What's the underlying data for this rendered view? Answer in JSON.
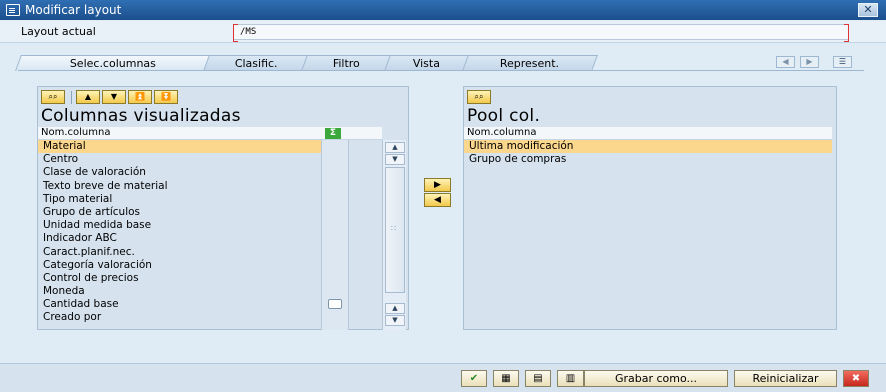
{
  "window": {
    "title": "Modificar layout",
    "close_label": "✕"
  },
  "layout": {
    "label": "Layout actual",
    "value": "/MS"
  },
  "tabs": [
    {
      "label": "Selec.columnas",
      "active": true
    },
    {
      "label": "Clasific.",
      "active": false
    },
    {
      "label": "Filtro",
      "active": false
    },
    {
      "label": "Vista",
      "active": false
    },
    {
      "label": "Represent.",
      "active": false
    }
  ],
  "left_panel": {
    "title": "Columnas visualizadas",
    "column_header": "Nom.columna",
    "sum_icon_label": "Σ",
    "items": [
      "Material",
      "Centro",
      "Clase de valoración",
      "Texto breve de material",
      "Tipo material",
      "Grupo de artículos",
      "Unidad medida base",
      "Indicador ABC",
      "Caract.planif.nec.",
      "Categoría valoración",
      "Control de precios",
      "Moneda",
      "Cantidad base",
      "Creado por"
    ],
    "selected_index": 0
  },
  "right_panel": {
    "title": "Pool col.",
    "column_header": "Nom.columna",
    "items": [
      "Última modificación",
      "Grupo de compras"
    ],
    "selected_index": 0
  },
  "move_buttons": {
    "add": "▶",
    "remove": "◀"
  },
  "footer": {
    "save_as_label": "Grabar como...",
    "reset_label": "Reinicializar",
    "ok_label": "✔",
    "cancel_label": "✖"
  },
  "icons": {
    "accent": "#fbd68d",
    "title_bar": "#2f6fb3"
  }
}
